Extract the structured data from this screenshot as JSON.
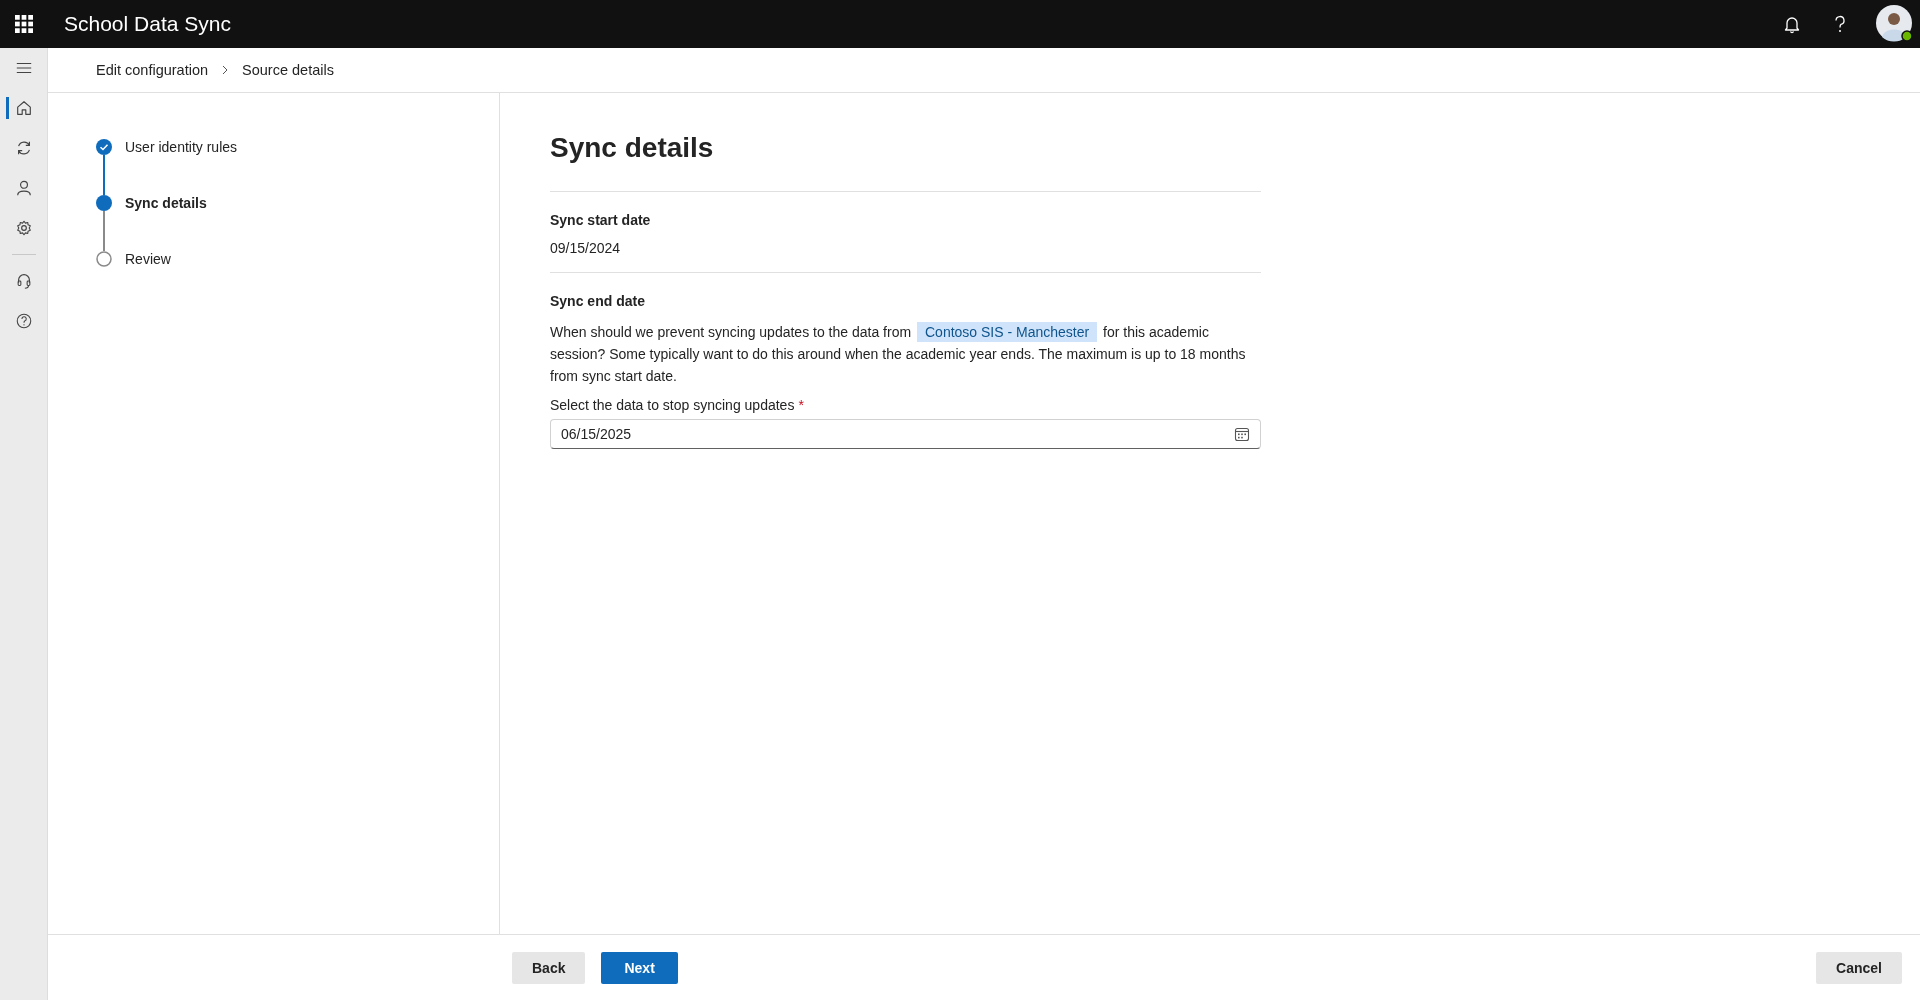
{
  "app": {
    "title": "School Data Sync"
  },
  "nav_items": [
    {
      "selected": true
    },
    {
      "selected": false
    },
    {
      "selected": false
    },
    {
      "selected": false
    },
    {
      "selected": false
    },
    {
      "selected": false
    }
  ],
  "breadcrumb": [
    "Edit configuration",
    "Source details"
  ],
  "steps": [
    {
      "label": "User identity rules",
      "kind": "completed",
      "selected": false
    },
    {
      "label": "Sync details",
      "kind": "current",
      "selected": true
    },
    {
      "label": "Review",
      "kind": "pending",
      "selected": false
    }
  ],
  "page_title": "Sync details",
  "start_date": {
    "heading": "Sync start date",
    "value": "09/15/2024"
  },
  "end_date": {
    "heading": "Sync end date",
    "description_before": "When should we prevent syncing updates to the data from",
    "source_tag": "Contoso SIS - Manchester",
    "description_after": "for this academic session? Some typically want to do this around when the academic year ends. The maximum is up to 18 months from sync start date.",
    "field_label": "Select the data to stop syncing updates",
    "required_mark": "*",
    "field_value": "06/15/2025"
  },
  "buttons": [
    {
      "label": "Back",
      "kind": "secondary"
    },
    {
      "label": "Next",
      "kind": "primary"
    },
    {
      "label": "Cancel",
      "kind": "secondary"
    }
  ]
}
